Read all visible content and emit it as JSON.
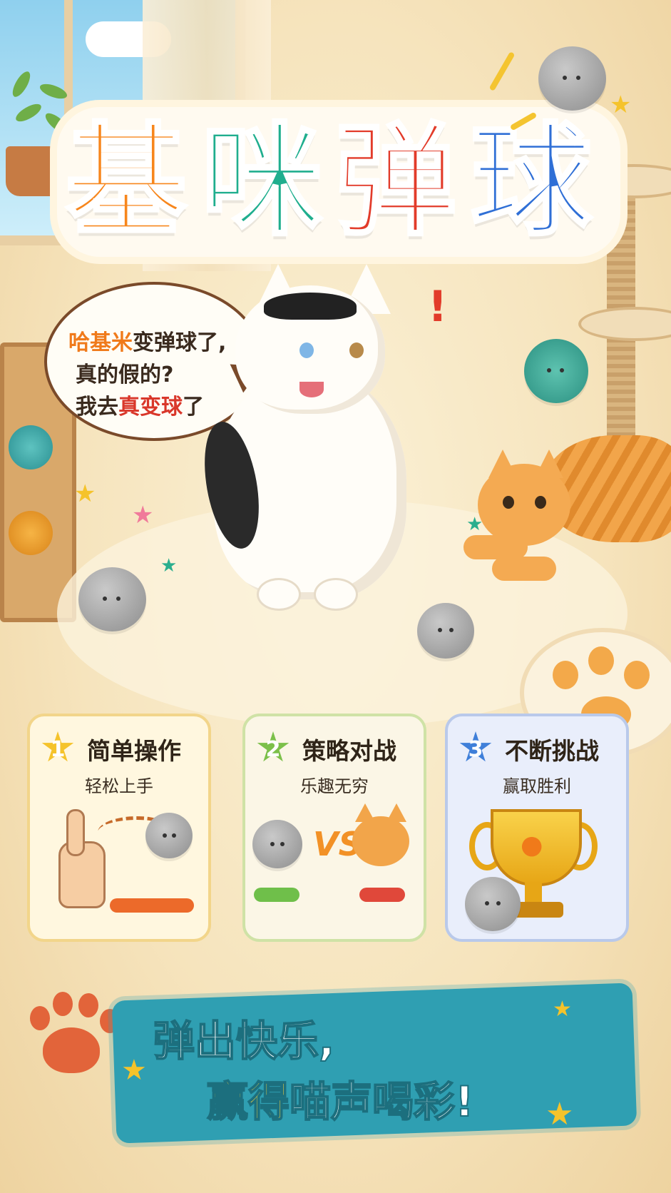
{
  "title": {
    "chars": [
      "基",
      "咪",
      "弹",
      "球"
    ],
    "colors": [
      "#f7861c",
      "#1fae8e",
      "#e23b2a",
      "#2f6fd6"
    ]
  },
  "speech": {
    "line1_highlight": "哈基米",
    "line1_rest": "变弹球了,",
    "line2": "真的假的?",
    "line3_prefix": "我去",
    "line3_highlight": "真变球",
    "line3_suffix": "了"
  },
  "features": [
    {
      "number": "1",
      "title": "简单操作",
      "subtitle": "轻松上手",
      "badge_color": "#f5c32b"
    },
    {
      "number": "2",
      "title": "策略对战",
      "subtitle": "乐趣无穷",
      "badge_color": "#7cc04a",
      "vs_text": "VS"
    },
    {
      "number": "3",
      "title": "不断挑战",
      "subtitle": "赢取胜利",
      "badge_color": "#3f7fd9"
    }
  ],
  "banner": {
    "line1": "弹出快乐,",
    "line2_highlight": "赢得",
    "line2_rest": "喵声喝彩!"
  },
  "colors": {
    "accent_orange": "#f07a1a",
    "accent_red": "#d9372a",
    "banner_teal": "#2f9fb2",
    "banner_yellow": "#ffd83b"
  },
  "icons": [
    "star-icon",
    "paw-icon",
    "trophy-icon",
    "yarn-ball-icon",
    "pointing-hand-icon"
  ]
}
